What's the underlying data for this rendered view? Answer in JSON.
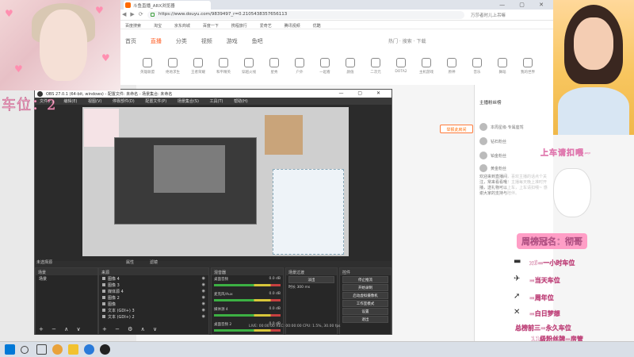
{
  "browser": {
    "tab_title": "斗鱼直播_ARX浏览器",
    "url": "https://www.douyu.com/9839497_r=0.2105438357656113",
    "search_hint": "万莎者时儿上吊嘛",
    "window_controls": "— ▢ ✕",
    "bookmarks": [
      "百度搜索",
      "淘宝",
      "京东商城",
      "百度一下",
      "携程旅行",
      "爱奇艺",
      "腾讯视频",
      "优酷",
      "微博",
      "网易"
    ],
    "site_nav": [
      "首页",
      "直播",
      "分类",
      "视频",
      "游戏",
      "鱼吧"
    ],
    "site_nav_active": 1,
    "site_right": "热门 · 搜索 · 下载",
    "categories": [
      "英雄联盟",
      "绝地求生",
      "王者荣耀",
      "和平精英",
      "穿越火线",
      "星秀",
      "户外",
      "一起看",
      "颜值",
      "二次元",
      "DOTA2",
      "主机游戏",
      "原神",
      "音乐",
      "舞蹈",
      "我的世界"
    ],
    "left_rail": [
      "首页",
      "直播",
      "分类"
    ],
    "report_button": "举报此房间",
    "side_title": "主播粉丝榜",
    "side_ranks": [
      "本周星级·专属座驾",
      "钻石粉丝",
      "铂金粉丝",
      "黄金粉丝"
    ],
    "side_desc": "欢迎来到直播间，喜欢主播的话点个关注，常来看看哦！主播每天晚上准时开播，送礼物可以上车，上车请扣喂~ 感谢大家的支持与陪伴。"
  },
  "obs": {
    "title": "OBS 27.0.1 (64-bit, windows) - 配置文件: 未命名 - 场景集合: 未命名",
    "window_controls": "— ▢ ✕",
    "menu": [
      "文件(F)",
      "编辑(E)",
      "视图(V)",
      "停靠部件(D)",
      "配置文件(P)",
      "场景集合(S)",
      "工具(T)",
      "帮助(H)"
    ],
    "docks": {
      "scenes": {
        "header": "场景",
        "items": [
          "场景"
        ]
      },
      "sources": {
        "header": "来源",
        "items": [
          "图像 4",
          "图像 3",
          "媒体源 4",
          "图像 2",
          "图像",
          "文本 (GDI+) 3",
          "文本 (GDI+) 2"
        ]
      },
      "mixer": {
        "header": "混音器",
        "channels": [
          {
            "name": "桌面音频",
            "level": "0.0 dB"
          },
          {
            "name": "麦克风/Aux",
            "level": "0.0 dB"
          },
          {
            "name": "媒体源 4",
            "level": "0.0 dB"
          },
          {
            "name": "桌面音频 2",
            "level": "0.0 dB"
          }
        ]
      },
      "transitions": {
        "header": "场景过渡",
        "type": "淡出",
        "duration_label": "时长",
        "duration": "300 ms"
      },
      "controls": {
        "header": "控件",
        "buttons": [
          "停止推流",
          "开始录制",
          "启动虚拟摄像机",
          "工作室模式",
          "设置",
          "退出"
        ]
      }
    },
    "status": "LIVE: 00:00:00   REC: 00:00:00   CPU: 1.5%, 30.00 fps",
    "source_props": "属性",
    "source_filters": "滤镜",
    "scene_label": "未选择源"
  },
  "overlays": {
    "left_text": "车位：2",
    "right_title": "上车请扣喂~",
    "rank_label": "周榜冠名：彻哥",
    "lines": [
      "x6=一小时车位",
      "=当天车位",
      "=周年位",
      "=白日梦想",
      "总榜前三=永久车位",
      "11级粉丝牌=房管"
    ]
  },
  "taskbar": {
    "clock": "",
    "icons": [
      "windows-start",
      "search",
      "task-view",
      "chrome",
      "game",
      "edge",
      "obs"
    ]
  },
  "colors": {
    "accent": "#ff5d23",
    "obs_bg": "#2b2b2b",
    "overlay_pink": "#ff9ec6"
  }
}
